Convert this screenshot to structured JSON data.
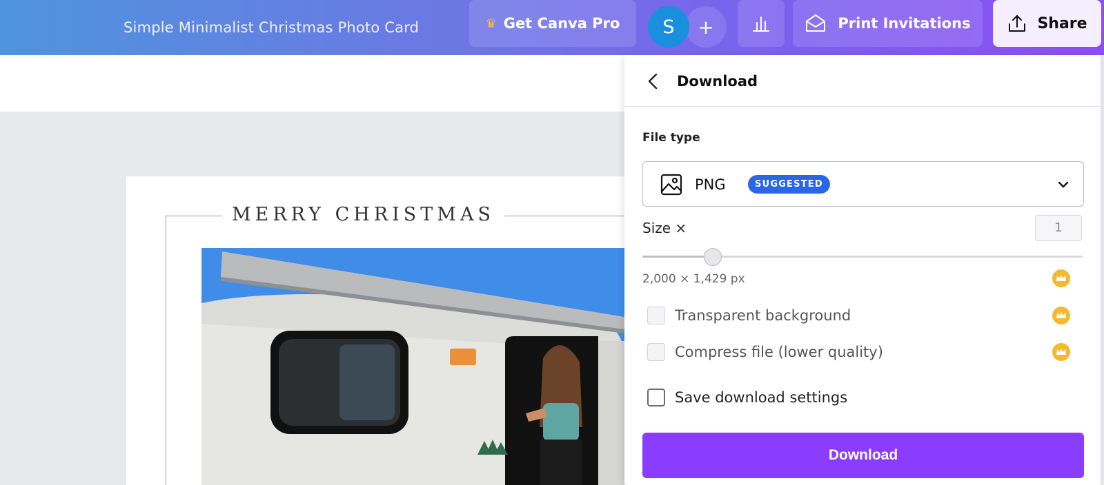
{
  "header": {
    "document_title": "Simple Minimalist Christmas Photo Card",
    "pro_label": "Get Canva Pro",
    "avatar_initial": "S",
    "add_label": "+",
    "print_label": "Print Invitations",
    "share_label": "Share"
  },
  "canvas": {
    "card_heading": "MERRY CHRISTMAS"
  },
  "download_panel": {
    "title": "Download",
    "file_type_label": "File type",
    "file_type_value": "PNG",
    "file_type_badge": "SUGGESTED",
    "size_label": "Size ×",
    "size_value": "1",
    "size_slider_fraction": 0.16,
    "dimensions": "2,000 × 1,429 px",
    "options": [
      {
        "label": "Transparent background",
        "checked": false,
        "pro": true
      },
      {
        "label": "Compress file (lower quality)",
        "checked": false,
        "pro": true
      },
      {
        "label": "Save download settings",
        "checked": false,
        "pro": false
      }
    ],
    "download_button": "Download"
  },
  "colors": {
    "accent": "#8b3dff",
    "badge": "#2a66e6",
    "pro_crown": "#f5b82e"
  }
}
